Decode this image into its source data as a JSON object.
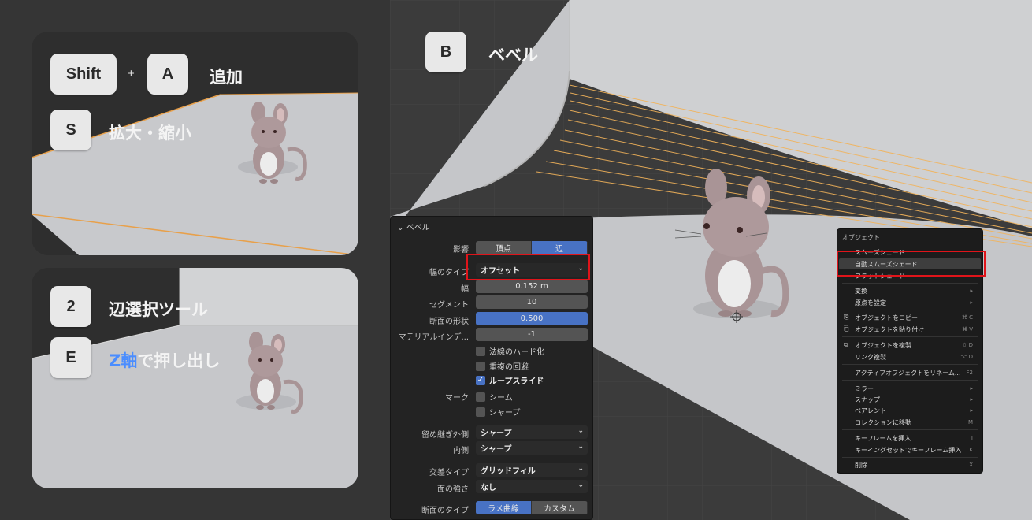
{
  "left_panels": {
    "panel1": {
      "key_shift": "Shift",
      "plus": "+",
      "key_a": "A",
      "label_add": "追加",
      "key_s": "S",
      "label_scale": "拡大・縮小"
    },
    "panel2": {
      "key_2": "2",
      "label_edge_select": "辺選択ツール",
      "key_e": "E",
      "label_extrude_axis": "Z軸",
      "label_extrude_rest": "で押し出し"
    }
  },
  "viewport": {
    "key_b": "B",
    "label_bevel": "ベベル"
  },
  "bevel_panel": {
    "header": "ベベル",
    "affect_label": "影響",
    "affect_options": [
      "頂点",
      "辺"
    ],
    "affect_selected": "辺",
    "width_type_label": "幅のタイプ",
    "width_type_value": "オフセット",
    "width_label": "幅",
    "width_value": "0.152 m",
    "segments_label": "セグメント",
    "segments_value": "10",
    "profile_shape_label": "断面の形状",
    "profile_shape_value": "0.500",
    "material_label": "マテリアルインデ...",
    "material_value": "-1",
    "harden_normals": "法線のハード化",
    "clamp_overlap": "重複の回避",
    "loop_slide": "ループスライド",
    "mark_label": "マーク",
    "mark_seam": "シーム",
    "mark_sharp": "シャープ",
    "miter_outer_label": "留め継ぎ外側",
    "miter_outer_value": "シャープ",
    "miter_inner_label": "内側",
    "miter_inner_value": "シャープ",
    "intersection_label": "交差タイプ",
    "intersection_value": "グリッドフィル",
    "face_strength_label": "面の強さ",
    "face_strength_value": "なし",
    "profile_type_label": "断面のタイプ",
    "profile_type_options": [
      "ラメ曲線",
      "カスタム"
    ],
    "profile_type_selected": "ラメ曲線"
  },
  "object_menu": {
    "title": "オブジェクト",
    "items": [
      {
        "label": "スムーズシェード",
        "shortcut": ""
      },
      {
        "label": "自動スムーズシェード",
        "shortcut": ""
      },
      {
        "label": "フラットシェード",
        "shortcut": ""
      },
      {
        "label": "変換",
        "shortcut": "▸"
      },
      {
        "label": "原点を設定",
        "shortcut": "▸"
      },
      {
        "label": "オブジェクトをコピー",
        "shortcut": "⌘ C"
      },
      {
        "label": "オブジェクトを貼り付け",
        "shortcut": "⌘ V"
      },
      {
        "label": "オブジェクトを複製",
        "shortcut": "⇧ D"
      },
      {
        "label": "リンク複製",
        "shortcut": "⌥ D"
      },
      {
        "label": "アクティブオブジェクトをリネーム...",
        "shortcut": "F2"
      },
      {
        "label": "ミラー",
        "shortcut": "▸"
      },
      {
        "label": "スナップ",
        "shortcut": "▸"
      },
      {
        "label": "ペアレント",
        "shortcut": "▸"
      },
      {
        "label": "コレクションに移動",
        "shortcut": "M"
      },
      {
        "label": "キーフレームを挿入",
        "shortcut": "I"
      },
      {
        "label": "キーイングセットでキーフレーム挿入",
        "shortcut": "K"
      },
      {
        "label": "削除",
        "shortcut": "X"
      }
    ]
  },
  "colors": {
    "selection_accent": "#4872c4",
    "highlight_box": "#e0141a",
    "edge_selected": "#f2b35a",
    "floor": "#c7c8cb",
    "z_axis_text": "#4a8dff"
  }
}
